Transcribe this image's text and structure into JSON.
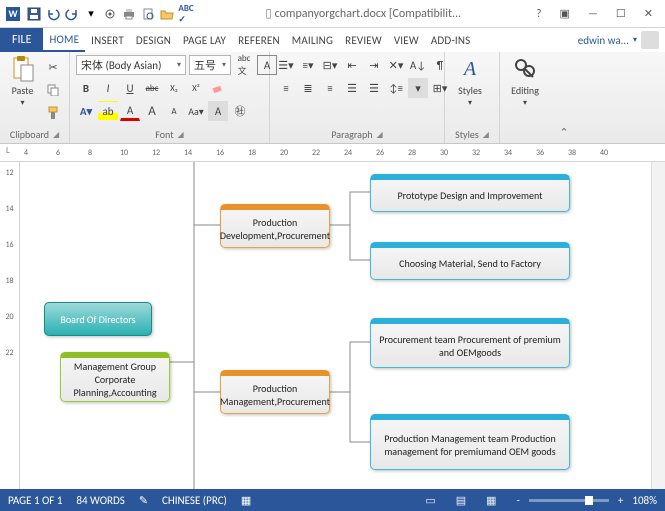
{
  "title": {
    "filename": "companyorgchart.docx",
    "mode": "[Compatibilit..."
  },
  "qat": {
    "save": "save",
    "undo": "undo",
    "redo": "redo",
    "print": "print",
    "spelling": "spelling"
  },
  "tabs": {
    "file": "FILE",
    "items": [
      "HOME",
      "INSERT",
      "DESIGN",
      "PAGE LAY",
      "REFEREN",
      "MAILING",
      "REVIEW",
      "VIEW",
      "ADD-INS"
    ],
    "active": 0
  },
  "user": {
    "name": "edwin wa..."
  },
  "ribbon": {
    "clipboard": {
      "label": "Clipboard",
      "paste": "Paste"
    },
    "font": {
      "label": "Font",
      "name": "宋体 (Body Asian)",
      "size": "五号",
      "bold": "B",
      "italic": "I",
      "underline": "U",
      "strike": "abc",
      "sub": "X₂",
      "sup": "X²",
      "grow": "A",
      "shrink": "A",
      "case": "Aa",
      "clear": "A",
      "color": "A",
      "highlight": "ab"
    },
    "paragraph": {
      "label": "Paragraph"
    },
    "styles": {
      "label": "Styles",
      "btn": "Styles"
    },
    "editing": {
      "label": "Editing",
      "btn": "Editing"
    }
  },
  "ruler": {
    "h": [
      "4",
      "6",
      "8",
      "10",
      "12",
      "14",
      "16",
      "18",
      "20",
      "22",
      "24",
      "26",
      "28",
      "30",
      "32",
      "34",
      "36",
      "38",
      "40"
    ],
    "v": [
      "12",
      "14",
      "16",
      "18",
      "20",
      "22"
    ]
  },
  "chart": {
    "n1": "Board Of Directors",
    "n2": "Management Group Corporate Planning,Accounting",
    "n3": "Production Development,Procurement",
    "n4": "Production Management,Procurement",
    "n5": "Prototype Design and Improvement",
    "n6": "Choosing Material, Send to Factory",
    "n7": "Procurement team Procurement of premium and OEMgoods",
    "n8": "Production Management team Production management for premiumand OEM goods"
  },
  "status": {
    "page": "PAGE 1 OF 1",
    "words": "84 WORDS",
    "lang": "CHINESE (PRC)",
    "zoom": "108%",
    "minus": "-",
    "plus": "+"
  }
}
